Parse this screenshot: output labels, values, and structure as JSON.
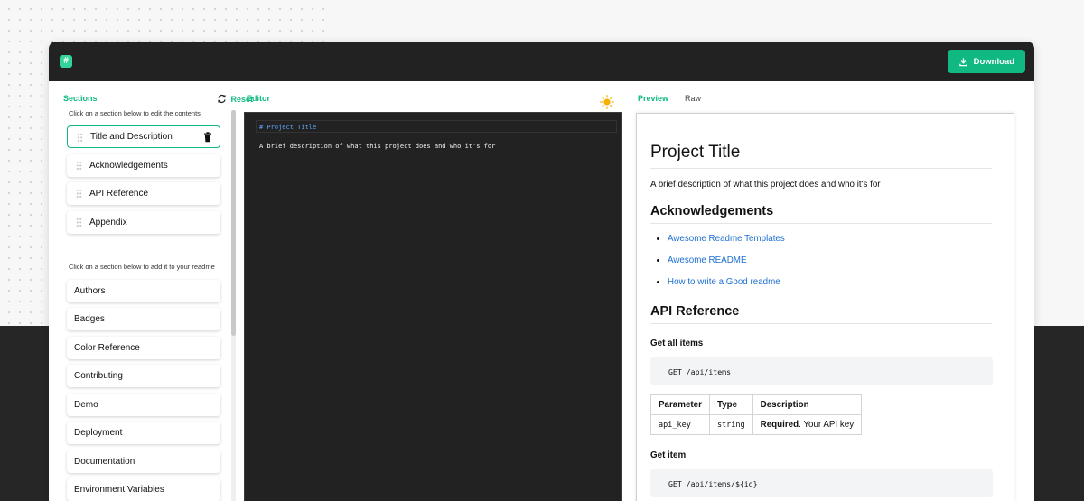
{
  "header": {
    "logo_glyph": "#",
    "download_label": "Download"
  },
  "sections": {
    "title": "Sections",
    "reset_label": "Reset",
    "edit_hint": "Click on a section below to edit the contents",
    "add_hint": "Click on a section below to add it to your readme",
    "selected": [
      {
        "label": "Title and Description"
      },
      {
        "label": "Acknowledgements"
      },
      {
        "label": "API Reference"
      },
      {
        "label": "Appendix"
      }
    ],
    "available": [
      {
        "label": "Authors"
      },
      {
        "label": "Badges"
      },
      {
        "label": "Color Reference"
      },
      {
        "label": "Contributing"
      },
      {
        "label": "Demo"
      },
      {
        "label": "Deployment"
      },
      {
        "label": "Documentation"
      },
      {
        "label": "Environment Variables"
      }
    ]
  },
  "editor": {
    "title": "Editor",
    "line1": "# Project Title",
    "line2": "A brief description of what this project does and who it's for"
  },
  "preview": {
    "tab_preview": "Preview",
    "tab_raw": "Raw",
    "h1": "Project Title",
    "description": "A brief description of what this project does and who it's for",
    "ack_heading": "Acknowledgements",
    "ack_links": [
      "Awesome Readme Templates",
      "Awesome README",
      "How to write a Good readme"
    ],
    "api_heading": "API Reference",
    "get_all_heading": "Get all items",
    "get_all_code": "GET /api/items",
    "table": {
      "headers": [
        "Parameter",
        "Type",
        "Description"
      ],
      "row": {
        "param": "api_key",
        "type": "string",
        "desc_bold": "Required",
        "desc_rest": ". Your API key"
      }
    },
    "get_item_heading": "Get item",
    "get_item_code": "GET /api/items/${id}"
  },
  "colors": {
    "accent": "#10b981",
    "link": "#1d6fd1",
    "topbar": "#222222"
  },
  "icons": [
    "logo-icon",
    "download-icon",
    "reset-icon",
    "drag-handle-icon",
    "trash-icon",
    "theme-toggle-sun-icon"
  ]
}
